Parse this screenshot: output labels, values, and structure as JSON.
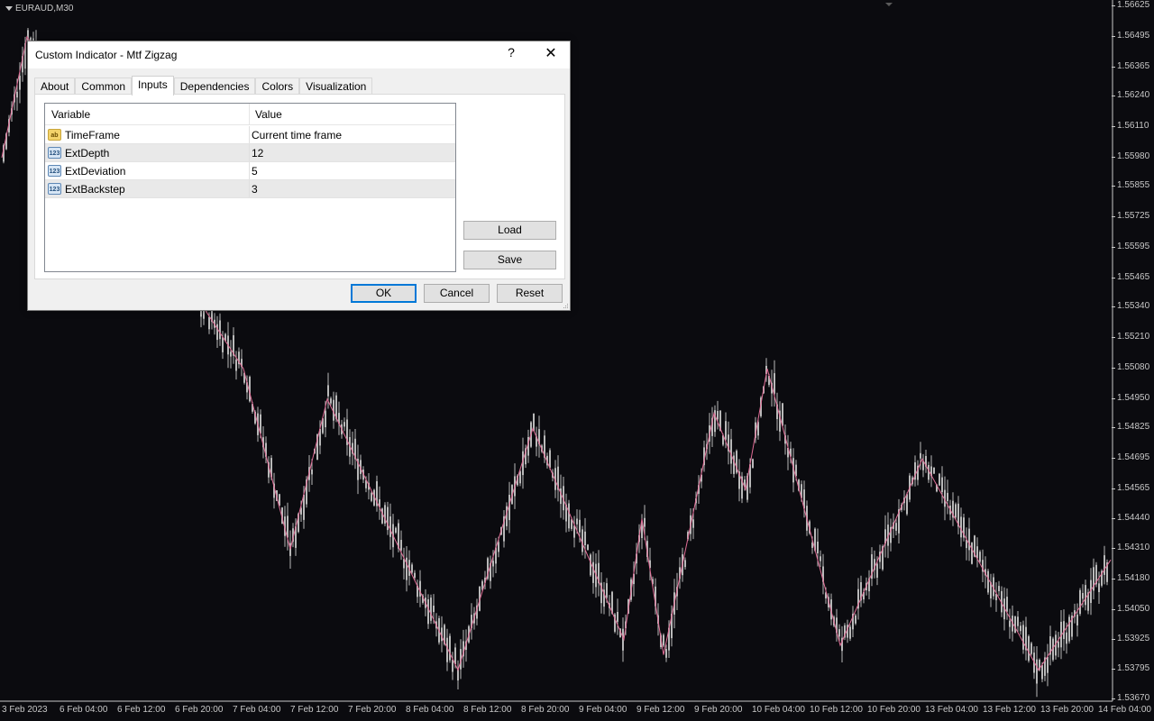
{
  "chart": {
    "symbol_label": "EURAUD,M30",
    "price_ticks": [
      "1.56625",
      "1.56495",
      "1.56365",
      "1.56240",
      "1.56110",
      "1.55980",
      "1.55855",
      "1.55725",
      "1.55595",
      "1.55465",
      "1.55340",
      "1.55210",
      "1.55080",
      "1.54950",
      "1.54825",
      "1.54695",
      "1.54565",
      "1.54440",
      "1.54310",
      "1.54180",
      "1.54050",
      "1.53925",
      "1.53795",
      "1.53670"
    ],
    "time_ticks": [
      "3 Feb 2023",
      "6 Feb 04:00",
      "6 Feb 12:00",
      "6 Feb 20:00",
      "7 Feb 04:00",
      "7 Feb 12:00",
      "7 Feb 20:00",
      "8 Feb 04:00",
      "8 Feb 12:00",
      "8 Feb 20:00",
      "9 Feb 04:00",
      "9 Feb 12:00",
      "9 Feb 20:00",
      "10 Feb 04:00",
      "10 Feb 12:00",
      "10 Feb 20:00",
      "13 Feb 04:00",
      "13 Feb 12:00",
      "13 Feb 20:00",
      "14 Feb 04:00"
    ],
    "colors": {
      "background": "#0b0b0f",
      "candle": "#b9b9b9",
      "zigzag": "#e06d96",
      "text": "#c8c8c8"
    },
    "zigzag_prices": [
      1.5598,
      1.56495,
      1.5508,
      1.5431,
      1.5495,
      1.53795,
      1.54825,
      1.53925,
      1.5444,
      1.5386,
      1.5489,
      1.54565,
      1.5508,
      1.539,
      1.54695,
      1.53795,
      1.54265
    ]
  },
  "dialog": {
    "title": "Custom Indicator - Mtf Zigzag",
    "help_label": "?",
    "close_label": "✕",
    "tabs": [
      {
        "label": "About"
      },
      {
        "label": "Common"
      },
      {
        "label": "Inputs"
      },
      {
        "label": "Dependencies"
      },
      {
        "label": "Colors"
      },
      {
        "label": "Visualization"
      }
    ],
    "active_tab": "Inputs",
    "grid": {
      "col_variable": "Variable",
      "col_value": "Value",
      "rows": [
        {
          "icon": "string-icon",
          "icon_text": "ab",
          "variable": "TimeFrame",
          "value": "Current time frame"
        },
        {
          "icon": "integer-icon",
          "icon_text": "123",
          "variable": "ExtDepth",
          "value": "12"
        },
        {
          "icon": "integer-icon",
          "icon_text": "123",
          "variable": "ExtDeviation",
          "value": "5"
        },
        {
          "icon": "integer-icon",
          "icon_text": "123",
          "variable": "ExtBackstep",
          "value": "3"
        }
      ]
    },
    "load_label": "Load",
    "save_label": "Save",
    "ok_label": "OK",
    "cancel_label": "Cancel",
    "reset_label": "Reset"
  }
}
